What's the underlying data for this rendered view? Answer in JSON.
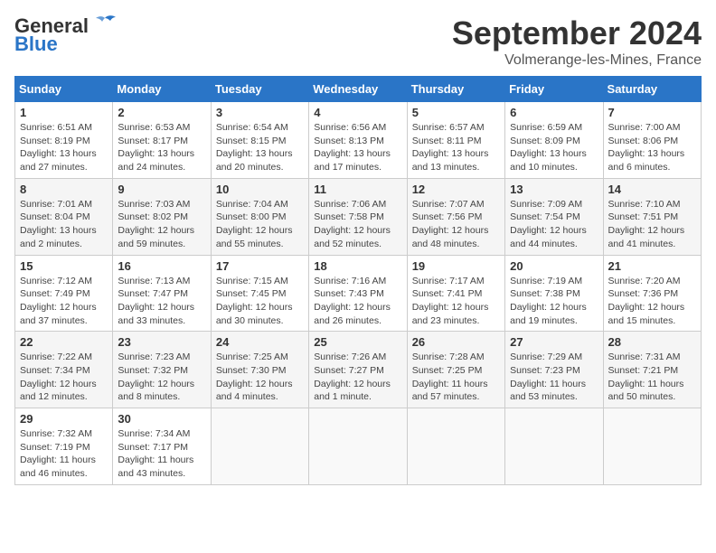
{
  "header": {
    "logo_general": "General",
    "logo_blue": "Blue",
    "month": "September 2024",
    "location": "Volmerange-les-Mines, France"
  },
  "weekdays": [
    "Sunday",
    "Monday",
    "Tuesday",
    "Wednesday",
    "Thursday",
    "Friday",
    "Saturday"
  ],
  "weeks": [
    [
      {
        "day": "1",
        "info": "Sunrise: 6:51 AM\nSunset: 8:19 PM\nDaylight: 13 hours\nand 27 minutes."
      },
      {
        "day": "2",
        "info": "Sunrise: 6:53 AM\nSunset: 8:17 PM\nDaylight: 13 hours\nand 24 minutes."
      },
      {
        "day": "3",
        "info": "Sunrise: 6:54 AM\nSunset: 8:15 PM\nDaylight: 13 hours\nand 20 minutes."
      },
      {
        "day": "4",
        "info": "Sunrise: 6:56 AM\nSunset: 8:13 PM\nDaylight: 13 hours\nand 17 minutes."
      },
      {
        "day": "5",
        "info": "Sunrise: 6:57 AM\nSunset: 8:11 PM\nDaylight: 13 hours\nand 13 minutes."
      },
      {
        "day": "6",
        "info": "Sunrise: 6:59 AM\nSunset: 8:09 PM\nDaylight: 13 hours\nand 10 minutes."
      },
      {
        "day": "7",
        "info": "Sunrise: 7:00 AM\nSunset: 8:06 PM\nDaylight: 13 hours\nand 6 minutes."
      }
    ],
    [
      {
        "day": "8",
        "info": "Sunrise: 7:01 AM\nSunset: 8:04 PM\nDaylight: 13 hours\nand 2 minutes."
      },
      {
        "day": "9",
        "info": "Sunrise: 7:03 AM\nSunset: 8:02 PM\nDaylight: 12 hours\nand 59 minutes."
      },
      {
        "day": "10",
        "info": "Sunrise: 7:04 AM\nSunset: 8:00 PM\nDaylight: 12 hours\nand 55 minutes."
      },
      {
        "day": "11",
        "info": "Sunrise: 7:06 AM\nSunset: 7:58 PM\nDaylight: 12 hours\nand 52 minutes."
      },
      {
        "day": "12",
        "info": "Sunrise: 7:07 AM\nSunset: 7:56 PM\nDaylight: 12 hours\nand 48 minutes."
      },
      {
        "day": "13",
        "info": "Sunrise: 7:09 AM\nSunset: 7:54 PM\nDaylight: 12 hours\nand 44 minutes."
      },
      {
        "day": "14",
        "info": "Sunrise: 7:10 AM\nSunset: 7:51 PM\nDaylight: 12 hours\nand 41 minutes."
      }
    ],
    [
      {
        "day": "15",
        "info": "Sunrise: 7:12 AM\nSunset: 7:49 PM\nDaylight: 12 hours\nand 37 minutes."
      },
      {
        "day": "16",
        "info": "Sunrise: 7:13 AM\nSunset: 7:47 PM\nDaylight: 12 hours\nand 33 minutes."
      },
      {
        "day": "17",
        "info": "Sunrise: 7:15 AM\nSunset: 7:45 PM\nDaylight: 12 hours\nand 30 minutes."
      },
      {
        "day": "18",
        "info": "Sunrise: 7:16 AM\nSunset: 7:43 PM\nDaylight: 12 hours\nand 26 minutes."
      },
      {
        "day": "19",
        "info": "Sunrise: 7:17 AM\nSunset: 7:41 PM\nDaylight: 12 hours\nand 23 minutes."
      },
      {
        "day": "20",
        "info": "Sunrise: 7:19 AM\nSunset: 7:38 PM\nDaylight: 12 hours\nand 19 minutes."
      },
      {
        "day": "21",
        "info": "Sunrise: 7:20 AM\nSunset: 7:36 PM\nDaylight: 12 hours\nand 15 minutes."
      }
    ],
    [
      {
        "day": "22",
        "info": "Sunrise: 7:22 AM\nSunset: 7:34 PM\nDaylight: 12 hours\nand 12 minutes."
      },
      {
        "day": "23",
        "info": "Sunrise: 7:23 AM\nSunset: 7:32 PM\nDaylight: 12 hours\nand 8 minutes."
      },
      {
        "day": "24",
        "info": "Sunrise: 7:25 AM\nSunset: 7:30 PM\nDaylight: 12 hours\nand 4 minutes."
      },
      {
        "day": "25",
        "info": "Sunrise: 7:26 AM\nSunset: 7:27 PM\nDaylight: 12 hours\nand 1 minute."
      },
      {
        "day": "26",
        "info": "Sunrise: 7:28 AM\nSunset: 7:25 PM\nDaylight: 11 hours\nand 57 minutes."
      },
      {
        "day": "27",
        "info": "Sunrise: 7:29 AM\nSunset: 7:23 PM\nDaylight: 11 hours\nand 53 minutes."
      },
      {
        "day": "28",
        "info": "Sunrise: 7:31 AM\nSunset: 7:21 PM\nDaylight: 11 hours\nand 50 minutes."
      }
    ],
    [
      {
        "day": "29",
        "info": "Sunrise: 7:32 AM\nSunset: 7:19 PM\nDaylight: 11 hours\nand 46 minutes."
      },
      {
        "day": "30",
        "info": "Sunrise: 7:34 AM\nSunset: 7:17 PM\nDaylight: 11 hours\nand 43 minutes."
      },
      {
        "day": "",
        "info": ""
      },
      {
        "day": "",
        "info": ""
      },
      {
        "day": "",
        "info": ""
      },
      {
        "day": "",
        "info": ""
      },
      {
        "day": "",
        "info": ""
      }
    ]
  ]
}
